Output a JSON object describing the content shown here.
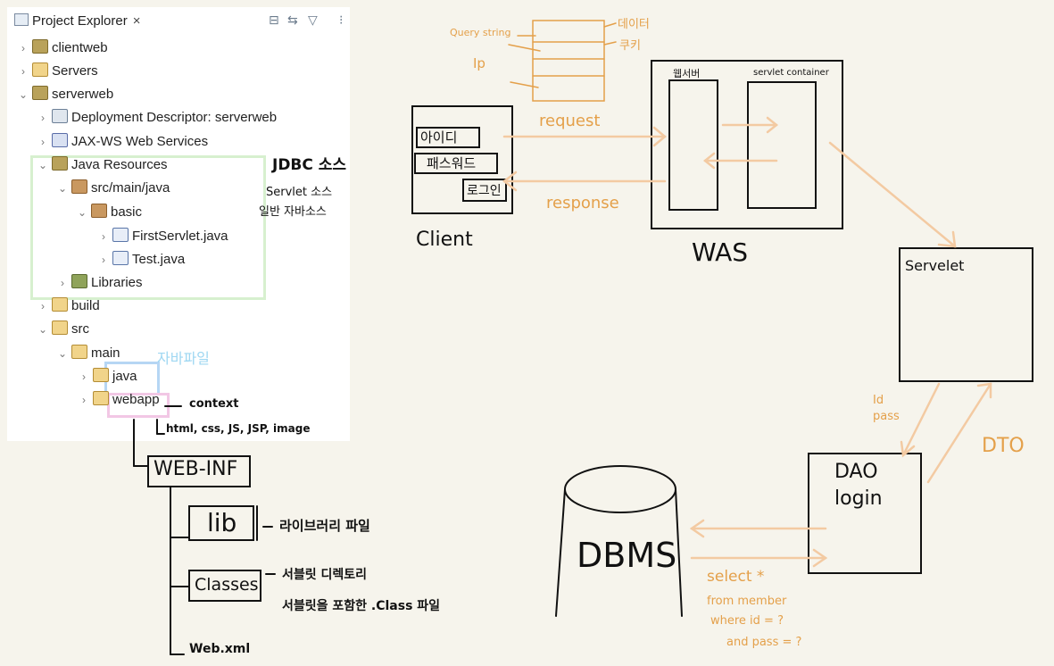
{
  "explorer": {
    "title": "Project Explorer",
    "close_glyph": "×",
    "tree": [
      {
        "label": "clientweb",
        "icon": "project-icon",
        "expanded": false
      },
      {
        "label": "Servers",
        "icon": "folder-icon",
        "expanded": false
      },
      {
        "label": "serverweb",
        "icon": "project-icon",
        "expanded": true
      },
      {
        "label": "Deployment Descriptor: serverweb",
        "icon": "deployment-descriptor-icon",
        "expanded": false
      },
      {
        "label": "JAX-WS Web Services",
        "icon": "web-services-icon",
        "expanded": false
      },
      {
        "label": "Java Resources",
        "icon": "java-resources-icon",
        "expanded": true
      },
      {
        "label": "src/main/java",
        "icon": "source-folder-icon",
        "expanded": true
      },
      {
        "label": "basic",
        "icon": "package-icon",
        "expanded": true
      },
      {
        "label": "FirstServlet.java",
        "icon": "java-file-icon",
        "expanded": false
      },
      {
        "label": "Test.java",
        "icon": "java-file-icon",
        "expanded": false
      },
      {
        "label": "Libraries",
        "icon": "libraries-icon",
        "expanded": false
      },
      {
        "label": "build",
        "icon": "folder-icon",
        "expanded": false
      },
      {
        "label": "src",
        "icon": "folder-icon",
        "expanded": true
      },
      {
        "label": "main",
        "icon": "folder-icon",
        "expanded": true
      },
      {
        "label": "java",
        "icon": "folder-icon",
        "expanded": false
      },
      {
        "label": "webapp",
        "icon": "folder-icon",
        "expanded": false
      }
    ]
  },
  "notes": {
    "jdbc": "JDBC 소스",
    "servlet_src": "Servlet 소스",
    "general_src": "일반 자바소스",
    "java_file": "자바파일",
    "context": "context",
    "web_files": "html, css, JS, JSP, image",
    "web_inf": "WEB-INF",
    "lib": "lib",
    "lib_desc": "라이브러리 파일",
    "classes": "Classes",
    "classes_desc1": "서블릿 디렉토리",
    "classes_desc2": "서블릿을 포함한 .Class 파일",
    "web_xml": "Web.xml"
  },
  "diagram": {
    "query_string": "Query string",
    "ip": "Ip",
    "data": "데이터",
    "cookie": "쿠키",
    "request": "request",
    "response": "response",
    "client_id": "아이디",
    "client_pw": "패스워드",
    "client_login": "로그인",
    "client": "Client",
    "web_server": "웹서버",
    "servlet_container": "servlet container",
    "was": "WAS",
    "servlet": "Servelet",
    "id_pass": "Id\npass",
    "dto": "DTO",
    "dao": "DAO\nlogin",
    "dbms": "DBMS",
    "sql1": "select *",
    "sql2": "from member",
    "sql3": "where id = ?",
    "sql4": "and pass = ?"
  },
  "colors": {
    "background": "#f6f4ec",
    "ink": "#111111",
    "orange": "#e4a04a",
    "peach": "#f3caa2",
    "highlight_green": "#d7f0cf",
    "highlight_blue": "#b6d6f4",
    "highlight_pink": "#f2c7e5"
  }
}
